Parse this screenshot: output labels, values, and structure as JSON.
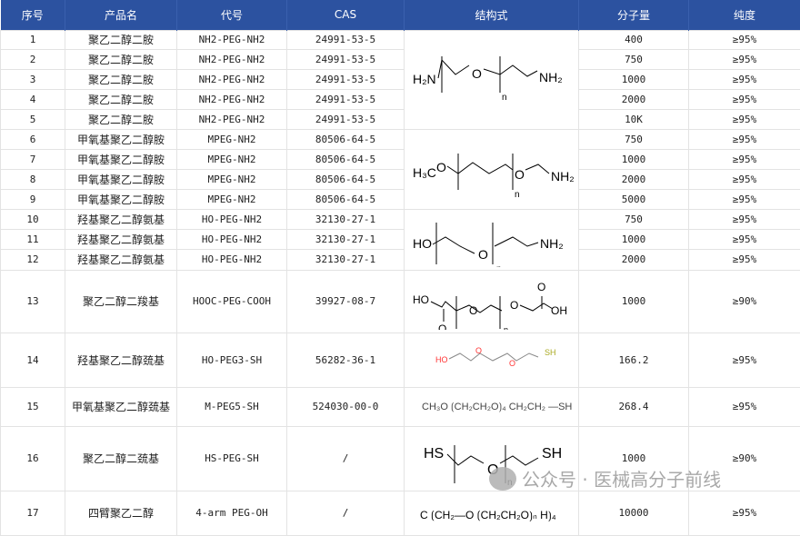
{
  "headers": [
    "序号",
    "产品名",
    "代号",
    "CAS",
    "结构式",
    "分子量",
    "纯度"
  ],
  "rows": [
    {
      "no": "1",
      "name": "聚乙二醇二胺",
      "code": "NH2-PEG-NH2",
      "cas": "24991-53-5",
      "mw": "400",
      "purity": "≥95%"
    },
    {
      "no": "2",
      "name": "聚乙二醇二胺",
      "code": "NH2-PEG-NH2",
      "cas": "24991-53-5",
      "mw": "750",
      "purity": "≥95%"
    },
    {
      "no": "3",
      "name": "聚乙二醇二胺",
      "code": "NH2-PEG-NH2",
      "cas": "24991-53-5",
      "mw": "1000",
      "purity": "≥95%"
    },
    {
      "no": "4",
      "name": "聚乙二醇二胺",
      "code": "NH2-PEG-NH2",
      "cas": "24991-53-5",
      "mw": "2000",
      "purity": "≥95%"
    },
    {
      "no": "5",
      "name": "聚乙二醇二胺",
      "code": "NH2-PEG-NH2",
      "cas": "24991-53-5",
      "mw": "10K",
      "purity": "≥95%"
    },
    {
      "no": "6",
      "name": "甲氧基聚乙二醇胺",
      "code": "MPEG-NH2",
      "cas": "80506-64-5",
      "mw": "750",
      "purity": "≥95%"
    },
    {
      "no": "7",
      "name": "甲氧基聚乙二醇胺",
      "code": "MPEG-NH2",
      "cas": "80506-64-5",
      "mw": "1000",
      "purity": "≥95%"
    },
    {
      "no": "8",
      "name": "甲氧基聚乙二醇胺",
      "code": "MPEG-NH2",
      "cas": "80506-64-5",
      "mw": "2000",
      "purity": "≥95%"
    },
    {
      "no": "9",
      "name": "甲氧基聚乙二醇胺",
      "code": "MPEG-NH2",
      "cas": "80506-64-5",
      "mw": "5000",
      "purity": "≥95%"
    },
    {
      "no": "10",
      "name": "羟基聚乙二醇氨基",
      "code": "HO-PEG-NH2",
      "cas": "32130-27-1",
      "mw": "750",
      "purity": "≥95%"
    },
    {
      "no": "11",
      "name": "羟基聚乙二醇氨基",
      "code": "HO-PEG-NH2",
      "cas": "32130-27-1",
      "mw": "1000",
      "purity": "≥95%"
    },
    {
      "no": "12",
      "name": "羟基聚乙二醇氨基",
      "code": "HO-PEG-NH2",
      "cas": "32130-27-1",
      "mw": "2000",
      "purity": "≥95%"
    },
    {
      "no": "13",
      "name": "聚乙二醇二羧基",
      "code": "HOOC-PEG-COOH",
      "cas": "39927-08-7",
      "mw": "1000",
      "purity": "≥90%"
    },
    {
      "no": "14",
      "name": "羟基聚乙二醇巯基",
      "code": "HO-PEG3-SH",
      "cas": "56282-36-1",
      "mw": "166.2",
      "purity": "≥95%"
    },
    {
      "no": "15",
      "name": "甲氧基聚乙二醇巯基",
      "code": "M-PEG5-SH",
      "cas": "524030-00-0",
      "mw": "268.4",
      "purity": "≥95%"
    },
    {
      "no": "16",
      "name": "聚乙二醇二巯基",
      "code": "HS-PEG-SH",
      "cas": "/",
      "mw": "1000",
      "purity": "≥90%"
    },
    {
      "no": "17",
      "name": "四臂聚乙二醇",
      "code": "4-arm PEG-OH",
      "cas": "/",
      "mw": "10000",
      "purity": "≥95%"
    }
  ],
  "structures": {
    "s1": {
      "left": "H₂N",
      "o": "O",
      "n": "n",
      "right": "NH₂"
    },
    "s2": {
      "left": "H₃C",
      "o1": "O",
      "o2": "O",
      "n": "n",
      "right": "NH₂"
    },
    "s3": {
      "left": "HO",
      "o": "O",
      "n": "n",
      "right": "NH₂"
    },
    "s4": {
      "left": "HO",
      "o1": "O",
      "o2": "O",
      "dbl1": "O",
      "dbl2": "O",
      "right": "OH",
      "n": "n"
    },
    "s5": {
      "left": "HO",
      "o1": "O",
      "o2": "O",
      "right": "SH"
    },
    "s6": {
      "formula": "CH₃O ⟮CH₂CH₂O⟯₄ CH₂CH₂ —SH"
    },
    "s7": {
      "left": "HS",
      "o": "O",
      "n": "n",
      "right": "SH"
    },
    "s8": {
      "formula": "C ⟮CH₂—O ⟮CH₂CH₂O⟯ₙ H⟯₄"
    }
  },
  "watermark": "公众号 · 医械高分子前线"
}
